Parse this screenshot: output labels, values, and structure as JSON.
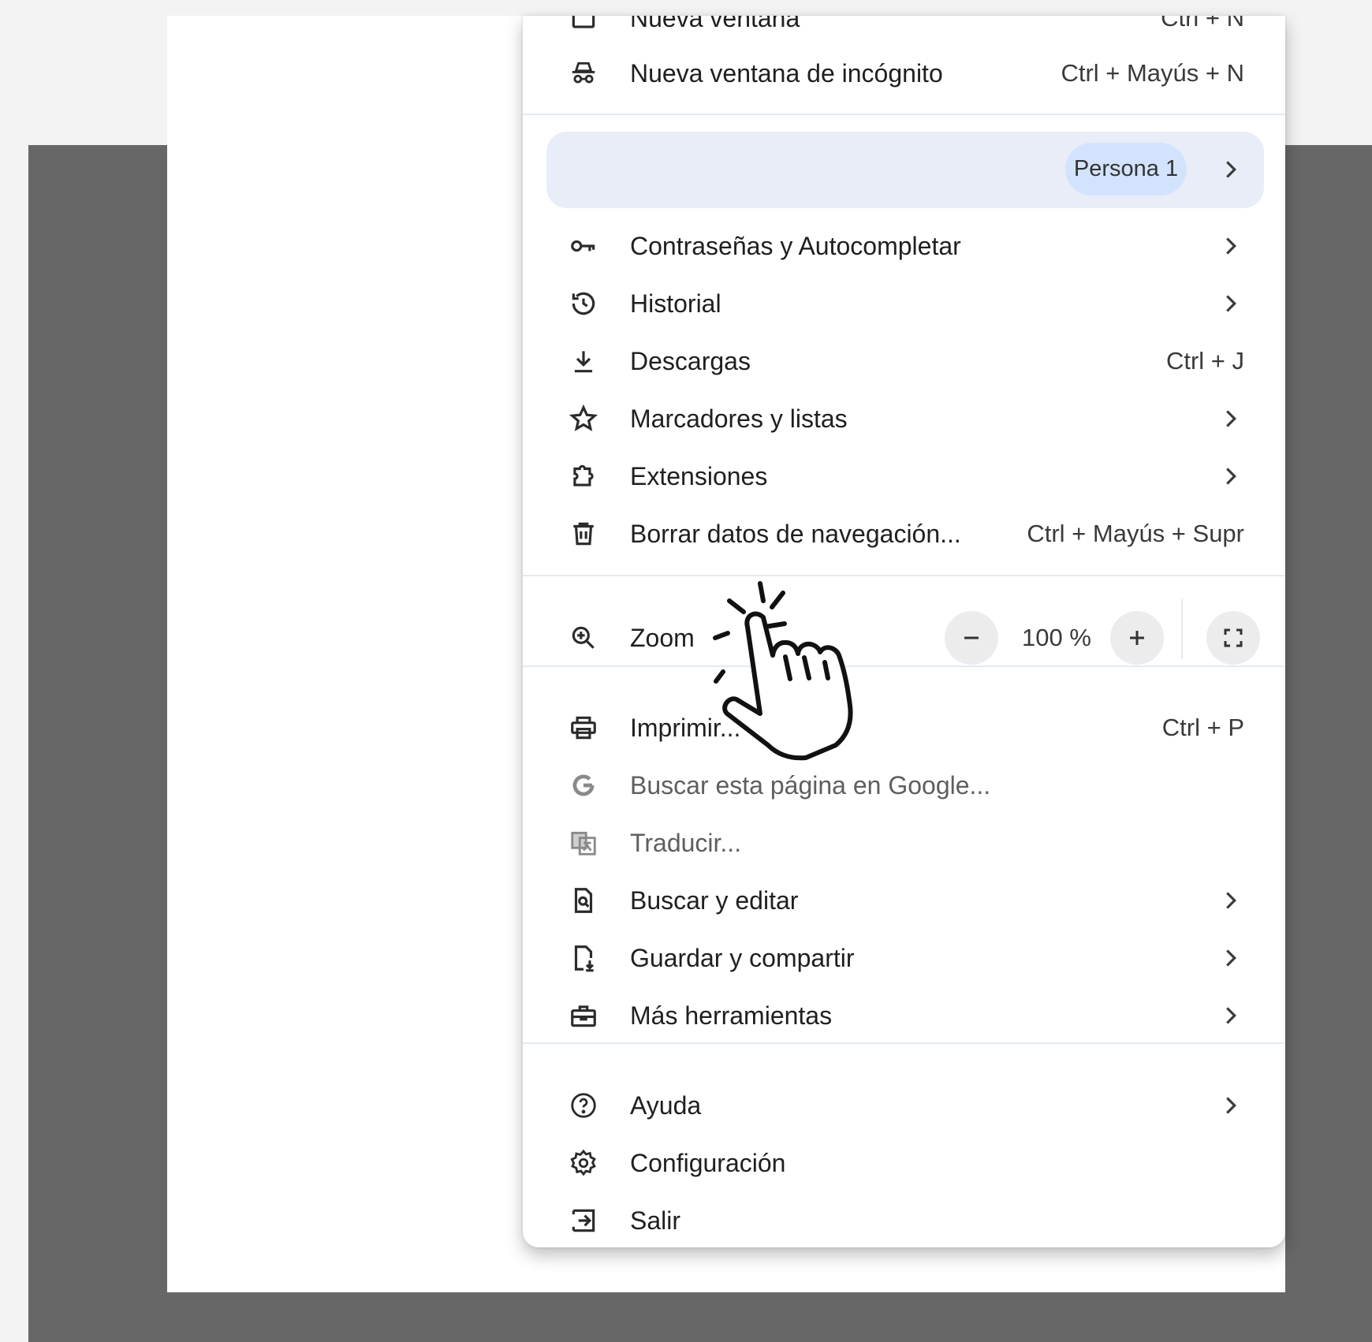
{
  "menu": {
    "partial_top": {
      "label": "Nueva ventana",
      "shortcut": "Ctrl + N",
      "icon": "new-window-icon"
    },
    "incognito": {
      "label": "Nueva ventana de incógnito",
      "shortcut": "Ctrl + Mayús + N",
      "icon": "incognito-icon"
    },
    "profile": {
      "name": "Persona 1"
    },
    "passwords": {
      "label": "Contraseñas y Autocompletar",
      "icon": "key-icon"
    },
    "history": {
      "label": "Historial",
      "icon": "history-icon"
    },
    "downloads": {
      "label": "Descargas",
      "shortcut": "Ctrl + J",
      "icon": "download-icon"
    },
    "bookmarks": {
      "label": "Marcadores y listas",
      "icon": "star-icon"
    },
    "extensions": {
      "label": "Extensiones",
      "icon": "puzzle-icon"
    },
    "clear_data": {
      "label": "Borrar datos de navegación...",
      "shortcut": "Ctrl + Mayús + Supr",
      "icon": "trash-icon"
    },
    "zoom": {
      "label": "Zoom",
      "minus": "−",
      "value": "100 %",
      "plus": "+",
      "icon": "zoom-in-icon"
    },
    "print": {
      "label": "Imprimir...",
      "shortcut": "Ctrl + P",
      "icon": "printer-icon"
    },
    "google_search": {
      "label": "Buscar esta página en Google...",
      "icon": "google-icon"
    },
    "translate": {
      "label": "Traducir...",
      "icon": "translate-icon"
    },
    "find_edit": {
      "label": "Buscar y editar",
      "icon": "find-page-icon"
    },
    "save_share": {
      "label": "Guardar y compartir",
      "icon": "save-share-icon"
    },
    "more_tools": {
      "label": "Más herramientas",
      "icon": "toolbox-icon"
    },
    "help": {
      "label": "Ayuda",
      "icon": "help-icon"
    },
    "settings": {
      "label": "Configuración",
      "icon": "gear-icon"
    },
    "exit": {
      "label": "Salir",
      "icon": "exit-icon"
    }
  },
  "colors": {
    "profile_bg": "#e9edf8",
    "profile_pill": "#d3e3fd",
    "separator": "#e4eaf3",
    "outer_bg": "#676767"
  }
}
